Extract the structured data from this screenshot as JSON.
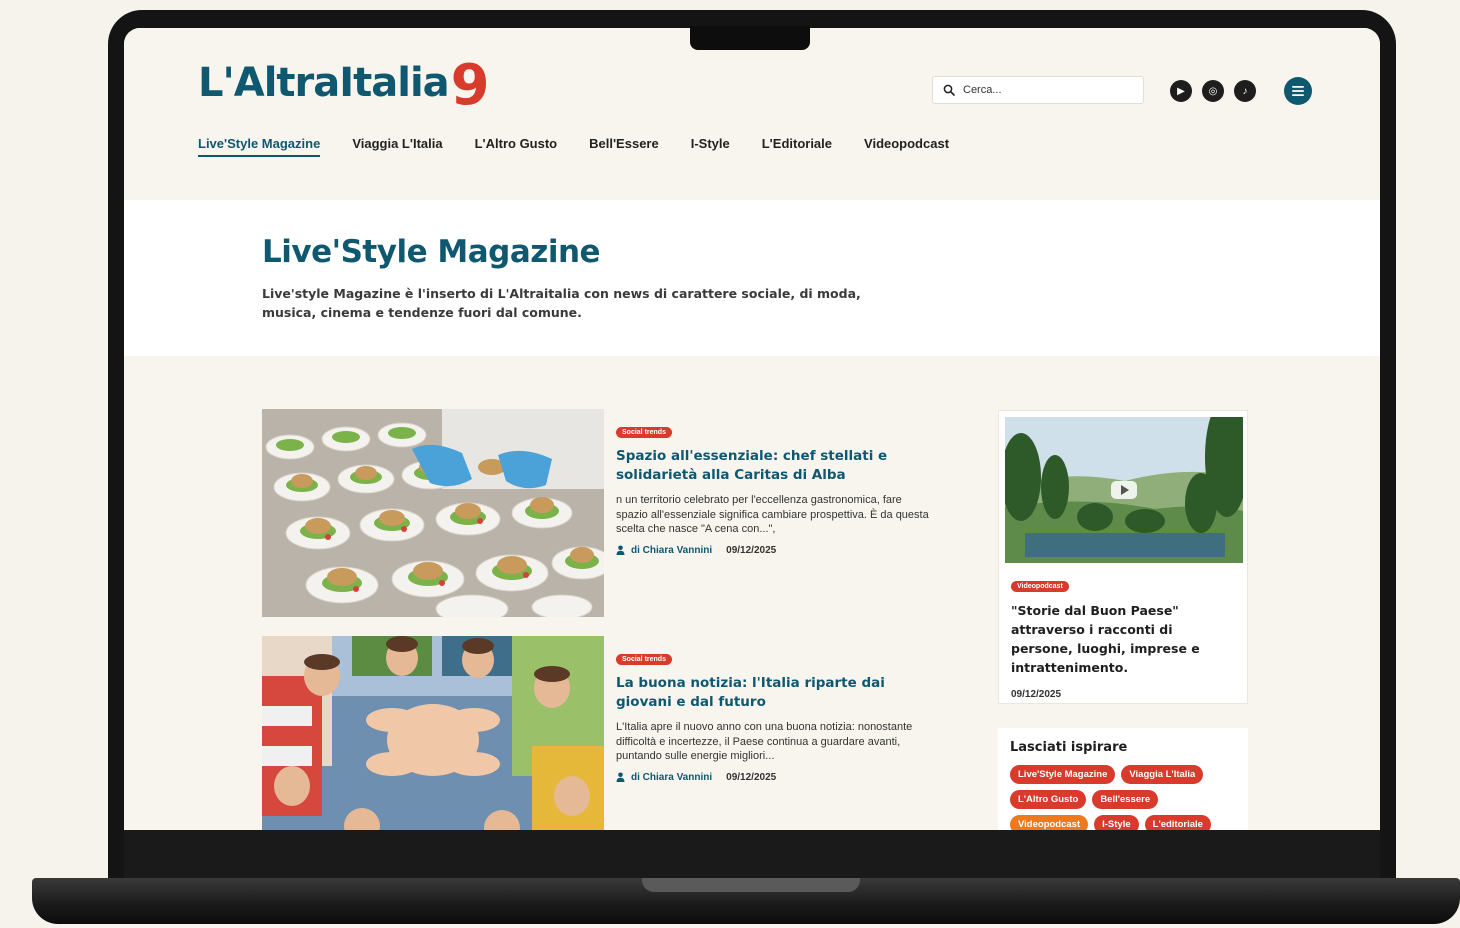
{
  "site": {
    "logo_text": "L'AltraItalia",
    "logo_mark": "9"
  },
  "search": {
    "placeholder": "Cerca..."
  },
  "social": [
    {
      "icon": "youtube-icon",
      "glyph": "▶"
    },
    {
      "icon": "instagram-icon",
      "glyph": "◎"
    },
    {
      "icon": "tiktok-icon",
      "glyph": "♪"
    }
  ],
  "nav": [
    {
      "label": "Live'Style Magazine",
      "active": true
    },
    {
      "label": "Viaggia L'Italia"
    },
    {
      "label": "L'Altro Gusto"
    },
    {
      "label": "Bell'Essere"
    },
    {
      "label": "I-Style"
    },
    {
      "label": "L'Editoriale"
    },
    {
      "label": "Videopodcast"
    }
  ],
  "hero": {
    "title": "Live'Style Magazine",
    "description": "Live'style Magazine è l'inserto di L'Altraitalia con news di carattere sociale, di moda, musica, cinema e tendenze fuori dal comune."
  },
  "articles": [
    {
      "badge": "Social trends",
      "title": "Spazio all'essenziale: chef stellati e solidarietà alla Caritas di Alba",
      "excerpt": "n un territorio celebrato per l'eccellenza gastronomica, fare spazio all'essenziale significa cambiare prospettiva. È da questa scelta che nasce \"A cena con...\",",
      "author": "di Chiara Vannini",
      "date": "09/12/2025"
    },
    {
      "badge": "Social trends",
      "title": "La buona notizia: l'Italia riparte dai giovani e dal futuro",
      "excerpt": "L'Italia apre il nuovo anno con una buona notizia: nonostante difficoltà e incertezze, il Paese continua a guardare avanti, puntando sulle energie migliori...",
      "author": "di Chiara Vannini",
      "date": "09/12/2025"
    }
  ],
  "video_card": {
    "badge": "Videopodcast",
    "title": "\"Storie dal Buon Paese\" attraverso i racconti di persone, luoghi, imprese e intrattenimento.",
    "date": "09/12/2025"
  },
  "tags_card": {
    "title": "Lasciati ispirare",
    "tags": [
      {
        "label": "Live'Style Magazine",
        "color": "#d83a2c"
      },
      {
        "label": "Viaggia L'Italia",
        "color": "#d83a2c"
      },
      {
        "label": "L'Altro Gusto",
        "color": "#d83a2c"
      },
      {
        "label": "Bell'essere",
        "color": "#d83a2c"
      },
      {
        "label": "Videopodcast",
        "color": "#ee7a1f"
      },
      {
        "label": "I-Style",
        "color": "#d83a2c"
      },
      {
        "label": "L'editoriale",
        "color": "#d83a2c"
      }
    ]
  },
  "colors": {
    "brand_teal": "#0f5870",
    "accent_red": "#d83a2c",
    "accent_orange": "#ee7a1f",
    "page_bg": "#f8f5ee"
  }
}
